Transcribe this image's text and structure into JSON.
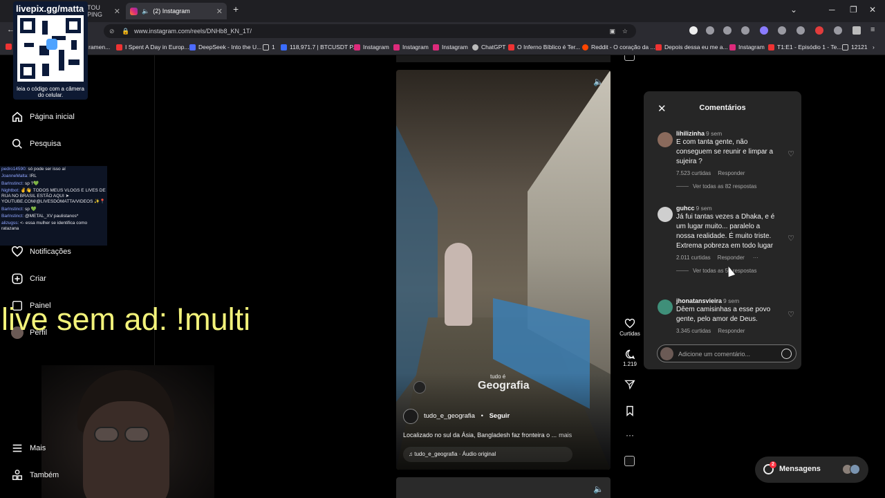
{
  "browser": {
    "tabs": [
      {
        "label": "TOU PING"
      },
      {
        "label": "(2) Instagram"
      }
    ],
    "new_tab": "+",
    "url": "www.instagram.com/reels/DNHb8_KN_1T/",
    "bookmarks": [
      "ramen...",
      "I Spent A Day in Europ...",
      "DeepSeek - Into the U...",
      "1",
      "118,971.7 | BTCUSDT P...",
      "Instagram",
      "Instagram",
      "Instagram",
      "ChatGPT",
      "O Inferno Bíblico é Ter...",
      "Reddit - O coração da ...",
      "Depois dessa eu me a...",
      "Instagram",
      "T1:E1 - Episódio 1 - Te...",
      "12121"
    ]
  },
  "overlay": {
    "qr_title": "livepix.gg/matta",
    "qr_caption": "leia o código com a câmera do celular.",
    "banner": "live sem ad: !multi",
    "chat": [
      {
        "user": "pedro14590:",
        "text": "só pode ser isso aí"
      },
      {
        "user": "JoanneMalta:",
        "text": "IRL"
      },
      {
        "user": "Barlnstinct:",
        "text": "sp ?💚"
      },
      {
        "user": "Nightbot:",
        "text": "✌️👋 TODOS MEUS VLOGS E LIVES DE RUA NO BRASIL ESTÃO AQUI ➤ YOUTUBE.COM/@LIVESDOMATTA/VIDEOS ✨📍"
      },
      {
        "user": "Barlnstinct:",
        "text": "sp 💚"
      },
      {
        "user": "Barlnstinct:",
        "text": "@METAL_XV paulistanos*"
      },
      {
        "user": "alizugss:",
        "text": "<- essa mulher se identifica como ratazana"
      }
    ]
  },
  "sidebar": {
    "items": [
      {
        "label": "Página inicial",
        "icon": "home-icon"
      },
      {
        "label": "Pesquisa",
        "icon": "search-icon"
      },
      {
        "label": "Notificações",
        "icon": "heart-icon"
      },
      {
        "label": "Criar",
        "icon": "create-icon"
      },
      {
        "label": "Painel",
        "icon": "dashboard-icon"
      },
      {
        "label": "Perfil",
        "icon": "avatar-icon"
      },
      {
        "label": "Mais",
        "icon": "menu-icon"
      },
      {
        "label": "Também",
        "icon": "apps-icon"
      }
    ]
  },
  "reel": {
    "author": "tudo_e_geografia",
    "follow": "Seguir",
    "separator": "•",
    "caption": "Localizado no sul da Ásia, Bangladesh faz fronteira o ...",
    "more": "mais",
    "audio": "tudo_e_geografia · Áudio original",
    "watermark_small": "tudo é",
    "watermark": "Geografia",
    "likes_label": "Curtidas",
    "comments_count": "1.219"
  },
  "comments": {
    "title": "Comentários",
    "items": [
      {
        "user": "lihilizinha",
        "time": "9 sem",
        "text": "E com tanta gente, não conseguem se reunir e limpar a sujeira ?",
        "likes": "7.523 curtidas",
        "reply": "Responder",
        "view_replies": "Ver todas as 82 respostas",
        "avatar_color": "#8a6a5c"
      },
      {
        "user": "guhcc",
        "time": "9 sem",
        "text": "Já fui tantas vezes a Dhaka, e é um lugar muito... paralelo a nossa realidade. É muito triste. Extrema pobreza em todo lugar",
        "likes": "2.011 curtidas",
        "reply": "Responder",
        "more": "···",
        "view_replies": "Ver todas as 50 respostas",
        "avatar_color": "#cfcfcf"
      },
      {
        "user": "jhonatansvieira",
        "time": "9 sem",
        "text": "Dêem camisinhas a esse povo gente, pelo amor de Deus.",
        "likes": "3.345 curtidas",
        "reply": "Responder",
        "avatar_color": "#3f8f79"
      }
    ],
    "input_placeholder": "Adicione um comentário..."
  },
  "messages": {
    "label": "Mensagens",
    "badge": "2"
  }
}
